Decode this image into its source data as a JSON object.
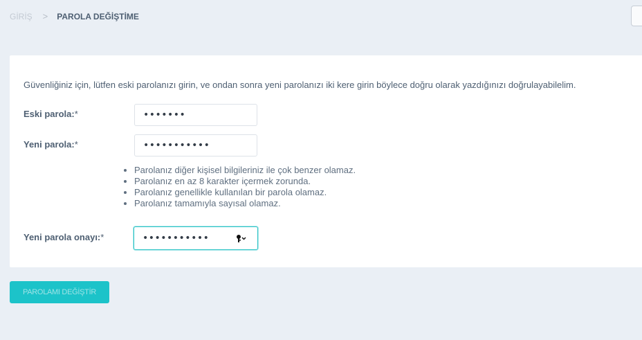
{
  "breadcrumb": {
    "home": "GİRİŞ",
    "separator": ">",
    "current": "PAROLA DEĞİŞTİME"
  },
  "form": {
    "intro": "Güvenliğiniz için, lütfen eski parolanızı girin, ve ondan sonra yeni parolanızı iki kere girin böylece doğru olarak yazdığınızı doğrulayabilelim.",
    "old_password": {
      "label": "Eski parola:",
      "required": "*",
      "value": "•••••••"
    },
    "new_password": {
      "label": "Yeni parola:",
      "required": "*",
      "value": "•••••••••••"
    },
    "help_items": [
      "Parolanız diğer kişisel bilgileriniz ile çok benzer olamaz.",
      "Parolanız en az 8 karakter içermek zorunda.",
      "Parolanız genellikle kullanılan bir parola olamaz.",
      "Parolanız tamamıyla sayısal olamaz."
    ],
    "confirm_password": {
      "label": "Yeni parola onayı:",
      "required": "*",
      "value": "•••••••••••"
    },
    "submit_label": "PAROLAMI DEĞİŞTİR"
  },
  "icons": {
    "password_manager": "key-icon"
  },
  "colors": {
    "accent": "#1cc3c9",
    "background": "#eaeff5",
    "text": "#4e5f72"
  }
}
